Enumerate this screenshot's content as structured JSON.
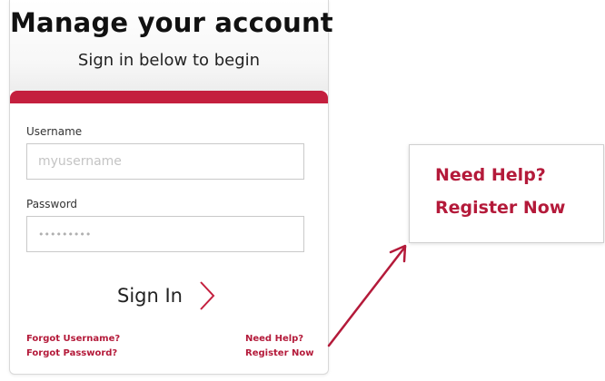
{
  "header": {
    "title": "Manage your account",
    "subtitle": "Sign in below to begin"
  },
  "form": {
    "username_label": "Username",
    "username_placeholder": "myusername",
    "password_label": "Password",
    "password_value": "•••••••••",
    "signin_label": "Sign In",
    "signin_icon": "chevron-right-icon"
  },
  "links": {
    "forgot_username": "Forgot Username?",
    "forgot_password": "Forgot Password?",
    "need_help": "Need Help?",
    "register_now": "Register Now"
  },
  "callout": {
    "need_help": "Need Help?",
    "register_now": "Register Now"
  },
  "colors": {
    "accent": "#c41f3e",
    "link": "#b41a3a"
  }
}
